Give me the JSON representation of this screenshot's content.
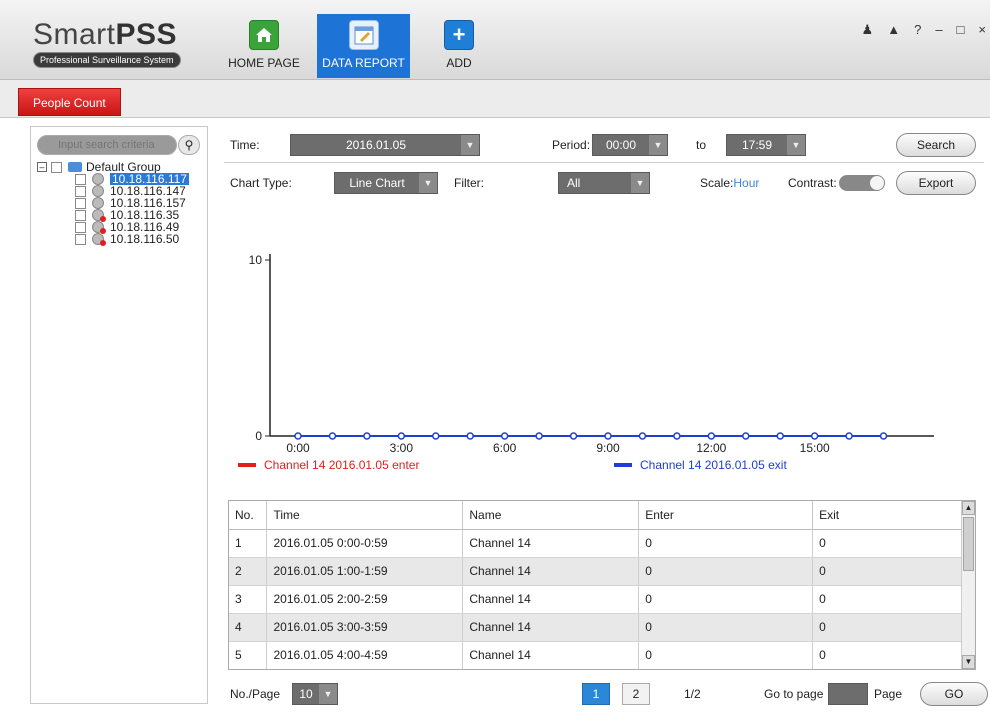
{
  "app": {
    "logo_main": "SmartPSS",
    "logo_sub": "Professional Surveillance System"
  },
  "nav": {
    "home": "HOME PAGE",
    "report": "DATA REPORT",
    "add": "ADD"
  },
  "window_controls": [
    "user-icon",
    "lock-icon",
    "help-icon",
    "minimize-icon",
    "maximize-icon",
    "close-icon"
  ],
  "tabs": {
    "people_count": "People Count"
  },
  "left": {
    "search_placeholder": "Input search criteria",
    "group": "Default Group",
    "devices": [
      {
        "ip": "10.18.116.117",
        "selected": true,
        "offline": false
      },
      {
        "ip": "10.18.116.147",
        "selected": false,
        "offline": false
      },
      {
        "ip": "10.18.116.157",
        "selected": false,
        "offline": false
      },
      {
        "ip": "10.18.116.35",
        "selected": false,
        "offline": true
      },
      {
        "ip": "10.18.116.49",
        "selected": false,
        "offline": true
      },
      {
        "ip": "10.18.116.50",
        "selected": false,
        "offline": true
      }
    ]
  },
  "filters": {
    "time_label": "Time:",
    "time_value": "2016.01.05",
    "period_label": "Period:",
    "period_from": "00:00",
    "to_label": "to",
    "period_to": "17:59",
    "search_button": "Search",
    "chart_type_label": "Chart Type:",
    "chart_type_value": "Line Chart",
    "filter_label": "Filter:",
    "filter_value": "All",
    "scale_label": "Scale:",
    "scale_value": "Hour",
    "contrast_label": "Contrast:",
    "export_button": "Export"
  },
  "chart_data": {
    "type": "line",
    "x_ticks": [
      "0:00",
      "3:00",
      "6:00",
      "9:00",
      "12:00",
      "15:00"
    ],
    "y_ticks": [
      "0",
      "10"
    ],
    "ylim": [
      0,
      10
    ],
    "x": [
      0,
      1,
      2,
      3,
      4,
      5,
      6,
      7,
      8,
      9,
      10,
      11,
      12,
      13,
      14,
      15,
      16,
      17
    ],
    "series": [
      {
        "name": "Channel 14 2016.01.05 enter",
        "color": "#e02020",
        "values": [
          0,
          0,
          0,
          0,
          0,
          0,
          0,
          0,
          0,
          0,
          0,
          0,
          0,
          0,
          0,
          0,
          0,
          0
        ]
      },
      {
        "name": "Channel 14 2016.01.05 exit",
        "color": "#1f3fd0",
        "values": [
          0,
          0,
          0,
          0,
          0,
          0,
          0,
          0,
          0,
          0,
          0,
          0,
          0,
          0,
          0,
          0,
          0,
          0
        ]
      }
    ]
  },
  "table": {
    "headers": [
      "No.",
      "Time",
      "Name",
      "Enter",
      "Exit"
    ],
    "rows": [
      [
        "1",
        "2016.01.05  0:00-0:59",
        "Channel 14",
        "0",
        "0"
      ],
      [
        "2",
        "2016.01.05  1:00-1:59",
        "Channel 14",
        "0",
        "0"
      ],
      [
        "3",
        "2016.01.05  2:00-2:59",
        "Channel 14",
        "0",
        "0"
      ],
      [
        "4",
        "2016.01.05  3:00-3:59",
        "Channel 14",
        "0",
        "0"
      ],
      [
        "5",
        "2016.01.05  4:00-4:59",
        "Channel 14",
        "0",
        "0"
      ]
    ]
  },
  "pager": {
    "per_page_label": "No./Page",
    "per_page_value": "10",
    "pages": [
      "1",
      "2"
    ],
    "current": "1",
    "indicator": "1/2",
    "goto_label": "Go to page",
    "page_label": "Page",
    "go_button": "GO"
  }
}
